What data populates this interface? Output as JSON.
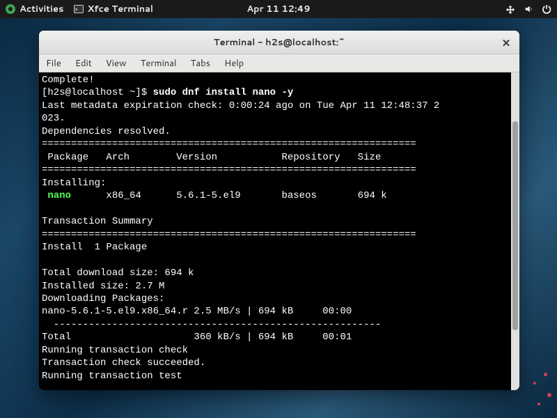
{
  "topbar": {
    "activities": "Activities",
    "app_name": "Xfce Terminal",
    "datetime": "Apr 11  12:49"
  },
  "window": {
    "title": "Terminal - h2s@localhost:~"
  },
  "menubar": {
    "file": "File",
    "edit": "Edit",
    "view": "View",
    "terminal": "Terminal",
    "tabs": "Tabs",
    "help": "Help"
  },
  "terminal_output": {
    "l1": "Complete!",
    "l2a": "[h2s@localhost ~]$ ",
    "l2b": "sudo dnf install nano -y",
    "l3": "Last metadata expiration check: 0:00:24 ago on Tue Apr 11 12:48:37 2",
    "l4": "023.",
    "l5": "Dependencies resolved.",
    "l6": "================================================================",
    "l7": " Package   Arch        Version           Repository   Size",
    "l8": "================================================================",
    "l9": "Installing:",
    "l10a": " ",
    "l10b": "nano",
    "l10c": "      x86_64      5.6.1-5.el9       baseos       694 k",
    "l11": "",
    "l12": "Transaction Summary",
    "l13": "================================================================",
    "l14": "Install  1 Package",
    "l15": "",
    "l16": "Total download size: 694 k",
    "l17": "Installed size: 2.7 M",
    "l18": "Downloading Packages:",
    "l19": "nano-5.6.1-5.el9.x86_64.r 2.5 MB/s | 694 kB     00:00",
    "l20": "  --------------------------------------------------------",
    "l21": "Total                     360 kB/s | 694 kB     00:01",
    "l22": "Running transaction check",
    "l23": "Transaction check succeeded.",
    "l24": "Running transaction test"
  }
}
